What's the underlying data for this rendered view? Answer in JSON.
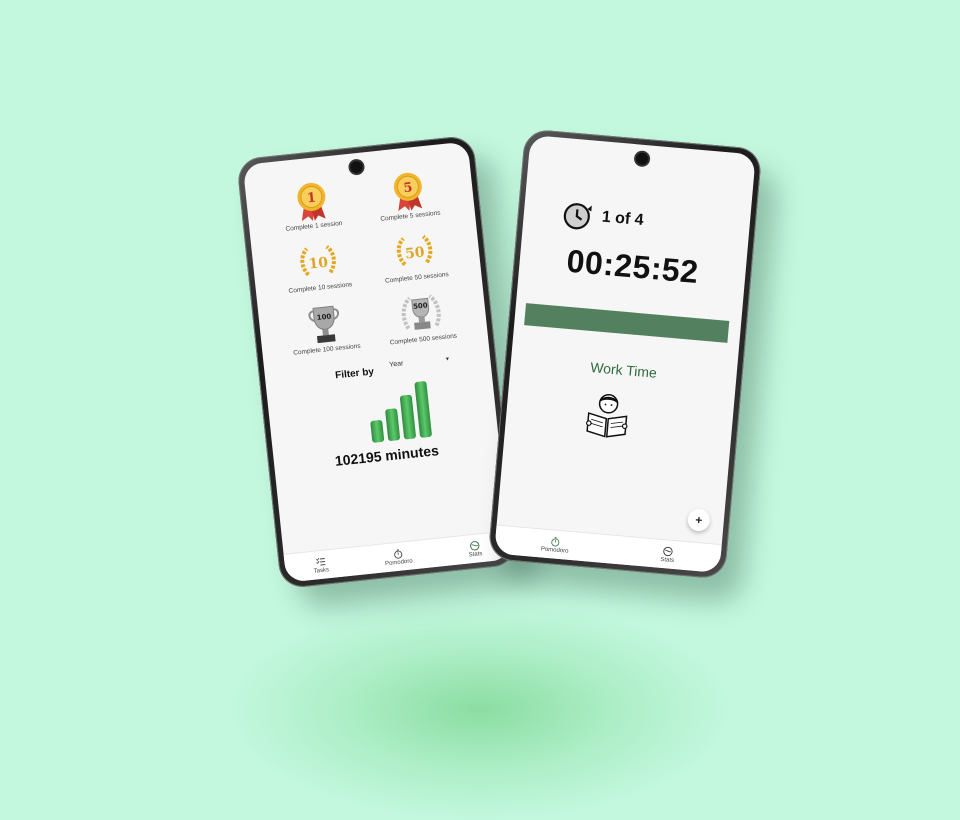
{
  "stats_screen": {
    "achievements": [
      {
        "label": "Complete 1 session",
        "icon": "gold-medal-1-icon",
        "number": "1"
      },
      {
        "label": "Complete 5 sessions",
        "icon": "gold-medal-5-icon",
        "number": "5"
      },
      {
        "label": "Complete 10 sessions",
        "icon": "gold-laurel-10-icon",
        "number": "10"
      },
      {
        "label": "Complete 50 sessions",
        "icon": "gold-laurel-50-icon",
        "number": "50"
      },
      {
        "label": "Complete 100 sessions",
        "icon": "silver-trophy-100-icon",
        "number": "100"
      },
      {
        "label": "Complete 500 sessions",
        "icon": "silver-trophy-500-icon",
        "number": "500"
      }
    ],
    "filter_label": "Filter by",
    "filter_value": "Year",
    "total_minutes": "102195 minutes",
    "nav": [
      {
        "label": "Tasks",
        "icon": "tasks-icon"
      },
      {
        "label": "Pomodoro",
        "icon": "stopwatch-icon"
      },
      {
        "label": "Stats",
        "icon": "stats-globe-icon",
        "active": true
      }
    ]
  },
  "pomodoro_screen": {
    "session_count": "1 of 4",
    "timer": "00:25:52",
    "progress": 1.0,
    "mode": "Work Time",
    "fab_label": "+",
    "nav": [
      {
        "label": "Pomodoro",
        "icon": "stopwatch-icon",
        "active": true
      },
      {
        "label": "Stats",
        "icon": "stats-globe-icon"
      }
    ]
  },
  "colors": {
    "background": "#c3f8df",
    "accent_green": "#538160",
    "bar_green": "#3aa84e",
    "gold": "#e6a823",
    "silver": "#9a9a9a"
  }
}
